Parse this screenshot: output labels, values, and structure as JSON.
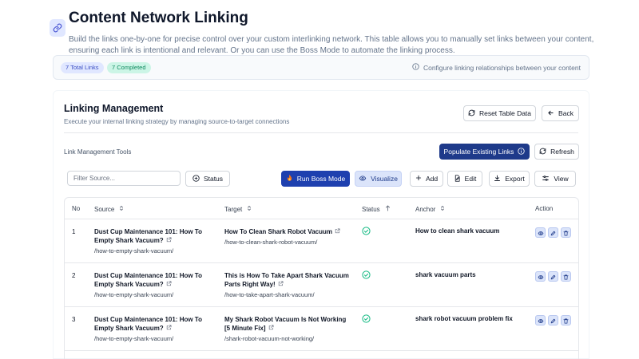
{
  "page": {
    "title": "Content Network Linking",
    "description": "Build the links one-by-one for precise control over your custom interlinking network. This table allows you to manually set links between your content, ensuring each link is intentional and relevant. Or you can use the Boss Mode to automate the linking process."
  },
  "summary": {
    "total_links": "7 Total Links",
    "completed": "7 Completed",
    "info": "Configure linking relationships between your content"
  },
  "panel": {
    "title": "Linking Management",
    "subtitle": "Execute your internal linking strategy by managing source-to-target connections",
    "reset_label": "Reset Table Data",
    "back_label": "Back",
    "tools_label": "Link Management Tools",
    "populate_label": "Populate Existing Links",
    "refresh_label": "Refresh"
  },
  "toolbar": {
    "filter_placeholder": "Filter Source...",
    "status_label": "Status",
    "boss_label": "Run Boss Mode",
    "visualize_label": "Visualize",
    "add_label": "Add",
    "edit_label": "Edit",
    "export_label": "Export",
    "view_label": "View"
  },
  "table": {
    "columns": {
      "no": "No",
      "source": "Source",
      "target": "Target",
      "status": "Status",
      "anchor": "Anchor",
      "action": "Action"
    },
    "rows": [
      {
        "no": "1",
        "source_line1": "Dust Cup Maintenance 101: How To",
        "source_line2": "Empty Shark Vacuum?",
        "source_url": "/how-to-empty-shark-vacuum/",
        "target_line1": "How To Clean Shark Robot Vacuum",
        "target_line2": "",
        "target_url": "/how-to-clean-shark-robot-vacuum/",
        "status": "completed",
        "anchor": "How to clean shark vacuum"
      },
      {
        "no": "2",
        "source_line1": "Dust Cup Maintenance 101: How To",
        "source_line2": "Empty Shark Vacuum?",
        "source_url": "/how-to-empty-shark-vacuum/",
        "target_line1": "This is How To Take Apart Shark Vacuum",
        "target_line2": "Parts Right Way!",
        "target_url": "/how-to-take-apart-shark-vacuum/",
        "status": "completed",
        "anchor": "shark vacuum parts"
      },
      {
        "no": "3",
        "source_line1": "Dust Cup Maintenance 101: How To",
        "source_line2": "Empty Shark Vacuum?",
        "source_url": "/how-to-empty-shark-vacuum/",
        "target_line1": "My Shark Robot Vacuum Is Not Working",
        "target_line2": "[5 Minute Fix]",
        "target_url": "/shark-robot-vacuum-not-working/",
        "status": "completed",
        "anchor": "shark robot vacuum problem fix"
      }
    ]
  },
  "colors": {
    "primary": "#1e3a8a",
    "accent": "#4f5bd5",
    "success": "#10b981",
    "boss": "#f97316"
  },
  "icons": [
    "link-icon",
    "info-icon",
    "refresh-icon",
    "arrow-left-icon",
    "plus-circle-icon",
    "flame-icon",
    "eye-icon",
    "plus-icon",
    "edit-icon",
    "download-icon",
    "sliders-icon",
    "sort-icon",
    "external-link-icon",
    "check-circle-icon",
    "pencil-icon",
    "trash-icon"
  ]
}
